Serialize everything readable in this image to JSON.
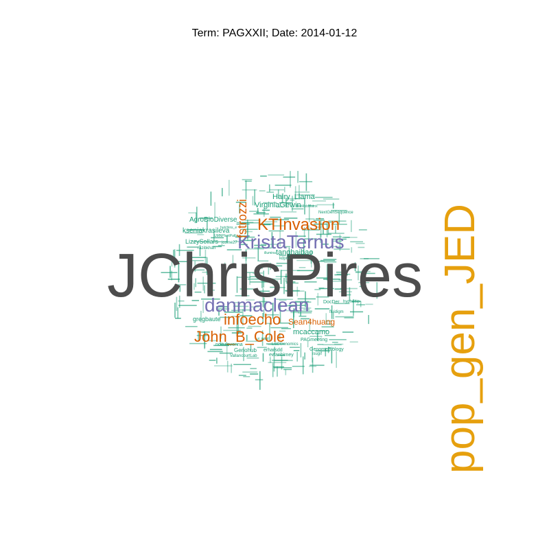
{
  "title": "Term: PAGXXII; Date: 2014-01-12",
  "colors": {
    "dark_gray": "#4d4d4d",
    "purple": "#7570b3",
    "orange": "#d95f02",
    "teal": "#1b9e77",
    "gold": "#e6a00e"
  },
  "words": [
    {
      "text": "JChrisPires",
      "color": "dark_gray"
    },
    {
      "text": "pop_gen_JED",
      "color": "gold"
    },
    {
      "text": "KristaTernus",
      "color": "purple"
    },
    {
      "text": "danmaclean",
      "color": "purple"
    },
    {
      "text": "KTInvasion",
      "color": "orange"
    },
    {
      "text": "John_B_Cole",
      "color": "orange"
    },
    {
      "text": "infoecho",
      "color": "orange"
    },
    {
      "text": "fstrozzi",
      "color": "orange"
    },
    {
      "text": "Sean4huang",
      "color": "orange"
    },
    {
      "text": "mcaccamo",
      "color": "teal"
    },
    {
      "text": "VirginiaGewin",
      "color": "teal"
    },
    {
      "text": "Hairy_Llama",
      "color": "teal"
    },
    {
      "text": "tanghaibao",
      "color": "teal"
    },
    {
      "text": "AgroBioDiverse",
      "color": "teal"
    },
    {
      "text": "kseniakrasileva",
      "color": "teal"
    },
    {
      "text": "LizzySollars",
      "color": "teal"
    },
    {
      "text": "gregbaute",
      "color": "teal"
    },
    {
      "text": "NextGenSequence",
      "color": "teal"
    },
    {
      "text": "DocDer",
      "color": "teal"
    },
    {
      "text": "hyphaltip",
      "color": "teal"
    },
    {
      "text": "Genohub",
      "color": "teal"
    },
    {
      "text": "erharsdd",
      "color": "teal"
    },
    {
      "text": "GenomeBiology",
      "color": "teal"
    },
    {
      "text": "PAGmeeting",
      "color": "teal"
    },
    {
      "text": "ewanbirney",
      "color": "teal"
    },
    {
      "text": "noitulovenna",
      "color": "teal"
    },
    {
      "text": "LSCGenomics",
      "color": "teal"
    },
    {
      "text": "VallancourtLab",
      "color": "teal"
    },
    {
      "text": "razibkhan",
      "color": "teal"
    },
    {
      "text": "jcome27",
      "color": "teal"
    },
    {
      "text": "kdpru",
      "color": "teal"
    },
    {
      "text": "isugif",
      "color": "teal"
    },
    {
      "text": "fluidigm",
      "color": "teal"
    },
    {
      "text": "illumina",
      "color": "teal"
    },
    {
      "text": "hutchins_e",
      "color": "teal"
    },
    {
      "text": "UMNPlantPath",
      "color": "teal"
    },
    {
      "text": "ui_mind",
      "color": "teal"
    },
    {
      "text": "BioMobMatrix",
      "color": "teal"
    }
  ]
}
